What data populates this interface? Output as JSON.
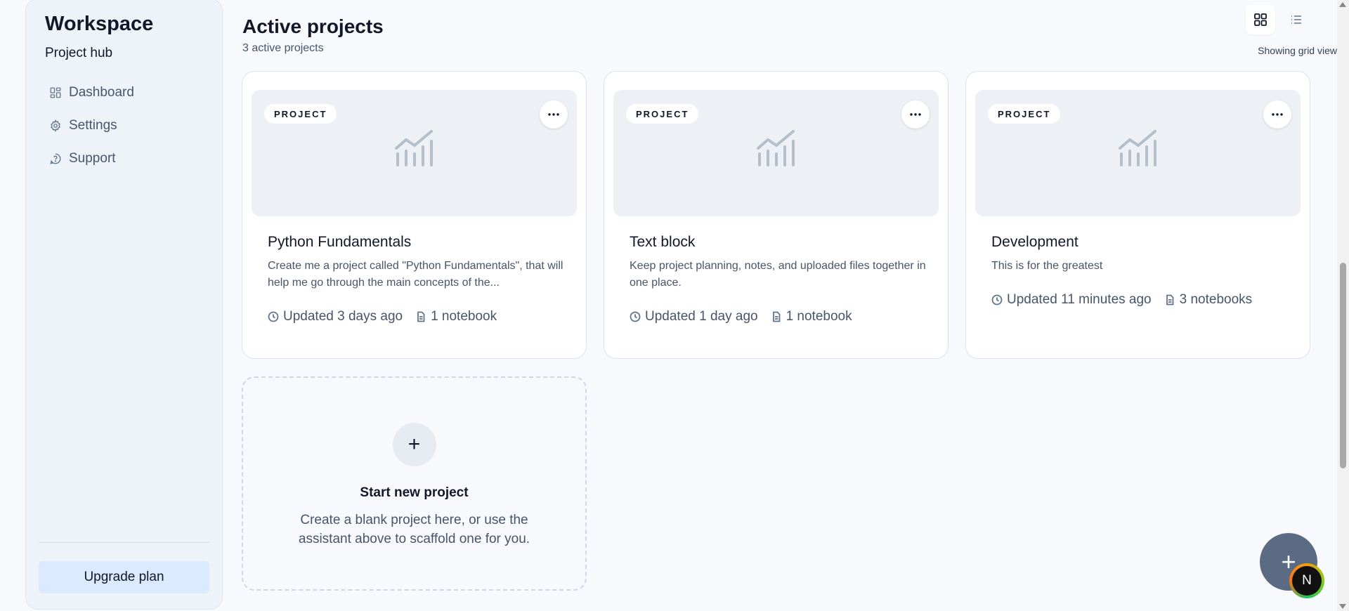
{
  "sidebar": {
    "title": "Workspace",
    "subtitle": "Project hub",
    "items": [
      {
        "label": "Dashboard",
        "icon": "dashboard-icon"
      },
      {
        "label": "Settings",
        "icon": "gear-icon"
      },
      {
        "label": "Support",
        "icon": "help-icon"
      }
    ],
    "upgrade_label": "Upgrade plan"
  },
  "header": {
    "title": "Active projects",
    "count": "3 active projects",
    "view_caption": "Showing grid view",
    "active_view": "grid"
  },
  "projects": [
    {
      "badge": "PROJECT",
      "title": "Python Fundamentals",
      "description": "Create me a project called \"Python Fundamentals\", that will help me go through the main concepts of the...",
      "updated": "Updated 3 days ago",
      "notebooks": "1 notebook"
    },
    {
      "badge": "PROJECT",
      "title": "Text block",
      "description": "Keep project planning, notes, and uploaded files together in one place.",
      "updated": "Updated 1 day ago",
      "notebooks": "1 notebook"
    },
    {
      "badge": "PROJECT",
      "title": "Development",
      "description": "This is for the greatest",
      "updated": "Updated 11 minutes ago",
      "notebooks": "3 notebooks"
    }
  ],
  "new_project": {
    "plus": "+",
    "title": "Start new project",
    "description": "Create a blank project here, or use the assistant above to scaffold one for you."
  },
  "fab": {
    "label": "+"
  },
  "avatar": {
    "initial": "N"
  },
  "colors": {
    "sidebar_bg": "#eef3f9",
    "upgrade_bg": "#dbeafe",
    "fab_bg": "#5a6b83",
    "text_primary": "#111827",
    "text_secondary": "#475569"
  }
}
